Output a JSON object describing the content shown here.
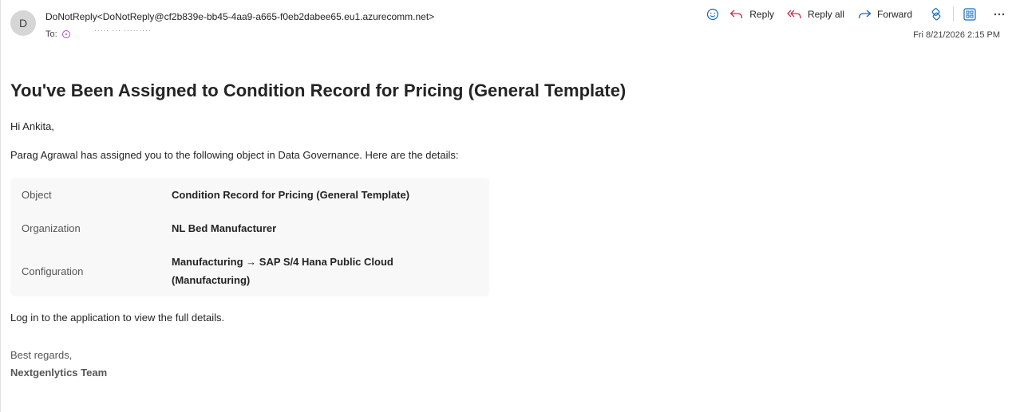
{
  "header": {
    "avatar_initial": "D",
    "sender": "DoNotReply<DoNotReply@cf2b839e-bb45-4aa9-a665-f0eb2dabee65.eu1.azurecomm.net>",
    "to_label": "To:",
    "recipient": "·····  ··· ·········",
    "date": "Fri 8/21/2026 2:15 PM"
  },
  "actions": {
    "reply": "Reply",
    "reply_all": "Reply all",
    "forward": "Forward"
  },
  "colors": {
    "accent": "#0f6cbd",
    "reply_icon": "#c4314b"
  },
  "icons": [
    "emoji-icon",
    "reply-icon",
    "reply-all-icon",
    "forward-icon",
    "loop-icon",
    "apps-icon",
    "more-icon"
  ],
  "message": {
    "title": "You've Been Assigned to Condition Record for Pricing (General Template)",
    "greeting": "Hi Ankita,",
    "intro": "Parag Agrawal has assigned you to the following object in Data Governance. Here are the details:",
    "details": [
      {
        "label": "Object",
        "value": "Condition Record for Pricing (General Template)"
      },
      {
        "label": "Organization",
        "value": "NL Bed Manufacturer"
      },
      {
        "label": "Configuration",
        "value": "Manufacturing → SAP S/4 Hana Public Cloud (Manufacturing)"
      }
    ],
    "login_note": "Log in to the application to view the full details.",
    "regards": "Best regards,",
    "team": "Nextgenlytics Team"
  }
}
